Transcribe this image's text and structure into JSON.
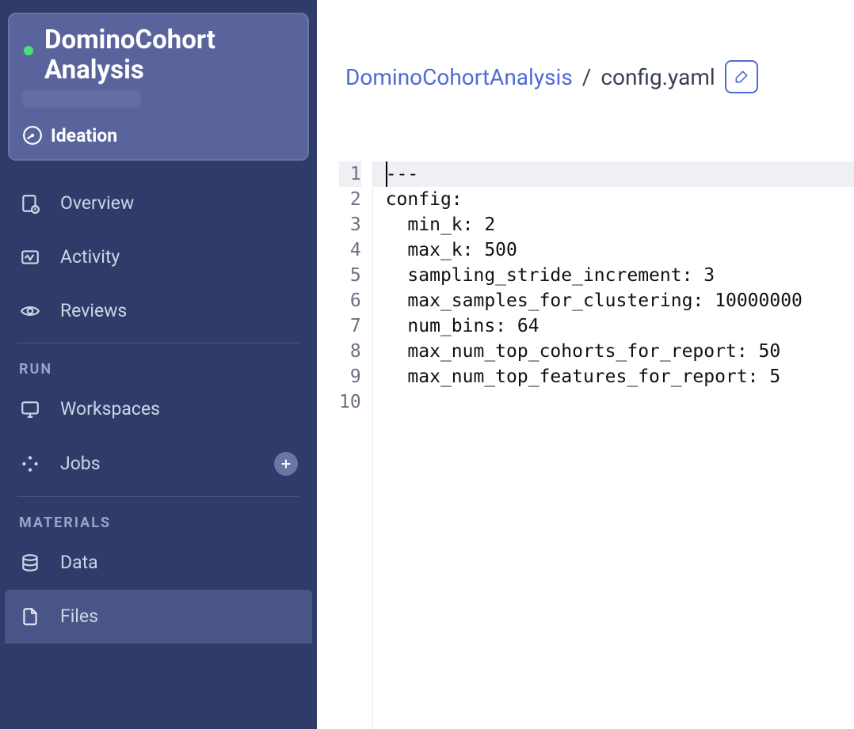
{
  "sidebar": {
    "project_title": "DominoCohort\nAnalysis",
    "status": "running",
    "phase_label": "Ideation",
    "nav": {
      "overview": "Overview",
      "activity": "Activity",
      "reviews": "Reviews"
    },
    "sections": {
      "run": "RUN",
      "materials": "MATERIALS"
    },
    "run_items": {
      "workspaces": "Workspaces",
      "jobs": "Jobs"
    },
    "materials_items": {
      "data": "Data",
      "files": "Files"
    }
  },
  "breadcrumb": {
    "root": "DominoCohortAnalysis",
    "sep": "/",
    "current": "config.yaml"
  },
  "editor": {
    "line_count": 10,
    "active_line": 1,
    "lines": [
      "---",
      "config:",
      "  min_k: 2",
      "  max_k: 500",
      "  sampling_stride_increment: 3",
      "  max_samples_for_clustering: 10000000",
      "  num_bins: 64",
      "  max_num_top_cohorts_for_report: 50",
      "  max_num_top_features_for_report: 5",
      ""
    ]
  },
  "colors": {
    "sidebar_bg": "#2f3b69",
    "accent_blue": "#4f6bd6",
    "status_green": "#4ade80"
  }
}
